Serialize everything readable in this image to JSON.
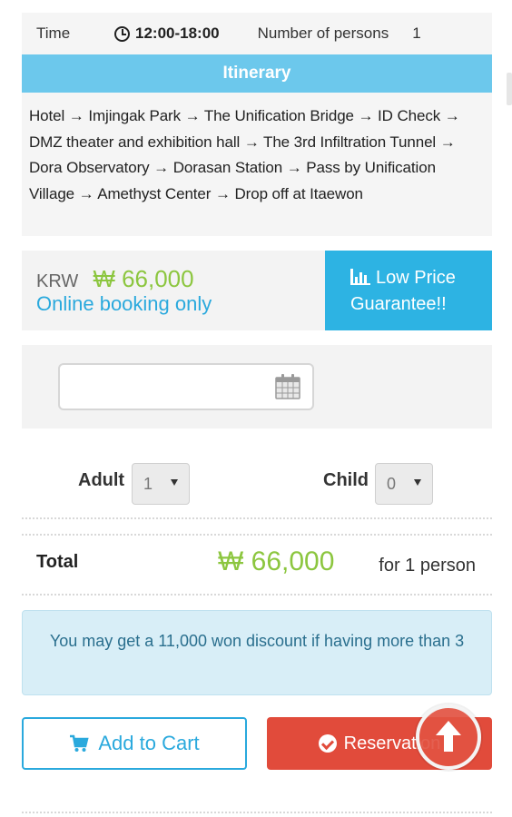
{
  "info": {
    "time_label": "Time",
    "time_value": "12:00-18:00",
    "persons_label": "Number of persons",
    "persons_value": "1"
  },
  "itinerary": {
    "title": "Itinerary",
    "text": "Hotel → Imjingak Park → The Unification Bridge → ID Check → DMZ theater and exhibition hall → The 3rd Infiltration Tunnel → Dora Observatory → Dorasan Station → Pass by Unification Village → Amethyst Center → Drop off at Itaewon"
  },
  "price": {
    "currency": "KRW",
    "amount": "₩ 66,000",
    "note": "Online booking only",
    "guarantee_line1": "Low Price",
    "guarantee_line2": "Guarantee!!"
  },
  "date_picker": {
    "value": "",
    "icon": "calendar-icon"
  },
  "quantity": {
    "adult_label": "Adult",
    "adult_value": "1",
    "child_label": "Child",
    "child_value": "0"
  },
  "total": {
    "label": "Total",
    "amount": "₩ 66,000",
    "for_text": "for 1 person"
  },
  "notice": {
    "text": "You may get a 11,000 won discount if having more than 3"
  },
  "actions": {
    "cart_label": "Add to Cart",
    "reservation_label": "Reservation",
    "cart_icon": "cart-icon",
    "reservation_icon": "check-circle-icon",
    "scroll_top_icon": "arrow-up-icon"
  },
  "colors": {
    "accent_blue": "#2aa9dd",
    "header_blue": "#6cc8ec",
    "price_green": "#8cc63f",
    "reservation_red": "#e14b3b"
  }
}
